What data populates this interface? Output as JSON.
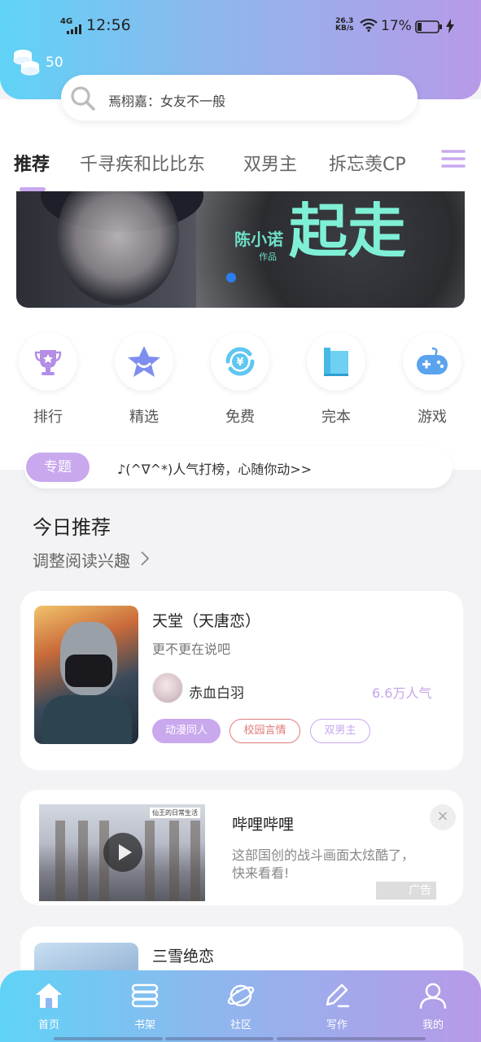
{
  "status_bar": {
    "network": "4G",
    "time": "12:56",
    "speed_value": "26.3",
    "speed_unit": "KB/s",
    "battery_pct": "17%"
  },
  "header": {
    "coin_count": "50",
    "search_placeholder": "焉栩嘉：女友不一般"
  },
  "tabs": [
    {
      "label": "推荐",
      "active": true
    },
    {
      "label": "千寻疾和比比东",
      "active": false
    },
    {
      "label": "双男主",
      "active": false
    },
    {
      "label": "拆忘羡CP",
      "active": false
    }
  ],
  "banner": {
    "author": "陈小诺",
    "tag": "作品",
    "title": "起走"
  },
  "quick_nav": [
    {
      "label": "排行",
      "icon": "trophy-icon"
    },
    {
      "label": "精选",
      "icon": "star-icon"
    },
    {
      "label": "免费",
      "icon": "yuan-icon"
    },
    {
      "label": "完本",
      "icon": "book-icon"
    },
    {
      "label": "游戏",
      "icon": "gamepad-icon"
    }
  ],
  "topic": {
    "badge": "专题",
    "text": "♪(^∇^*)人气打榜，心随你动>>"
  },
  "recommend": {
    "title": "今日推荐",
    "subtitle": "调整阅读兴趣"
  },
  "book1": {
    "title": "天堂（天唐恋）",
    "desc": "更不更在说吧",
    "author": "赤血白羽",
    "popularity": "6.6万人气",
    "tags": [
      {
        "label": "动漫同人",
        "color": "#c9a8ee"
      },
      {
        "label": "校园言情",
        "color": "#e07a7a"
      },
      {
        "label": "双男主",
        "color": "#c9a8ee"
      }
    ]
  },
  "ad": {
    "image_label": "仙王的日常生活",
    "name": "哔哩哔哩",
    "desc": "这部国创的战斗画面太炫酷了，快来看看!",
    "ad_tag": "广告",
    "close": "×"
  },
  "book2": {
    "title": "三雪绝恋"
  },
  "bottom_nav": [
    {
      "label": "首页",
      "icon": "home-icon"
    },
    {
      "label": "书架",
      "icon": "bookshelf-icon"
    },
    {
      "label": "社区",
      "icon": "planet-icon"
    },
    {
      "label": "写作",
      "icon": "pen-icon"
    },
    {
      "label": "我的",
      "icon": "user-icon"
    }
  ],
  "colors": {
    "accent": "#c9a8ee",
    "header_start": "#5fd3f6",
    "header_end": "#b79ae8"
  }
}
